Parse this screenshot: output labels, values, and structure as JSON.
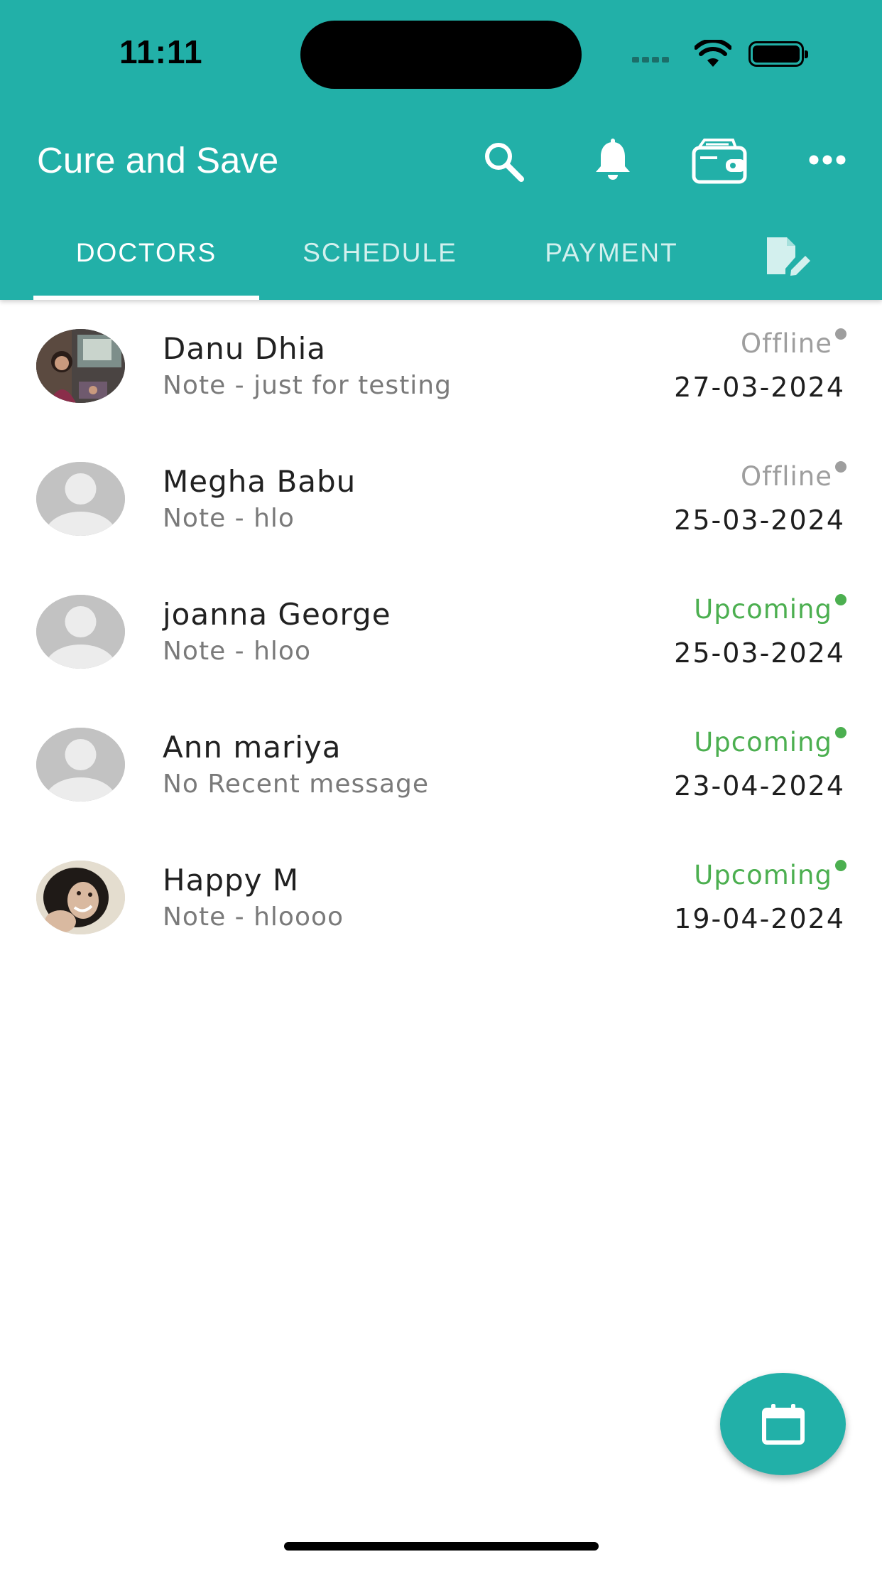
{
  "status_bar": {
    "time": "11:11"
  },
  "header": {
    "title": "Cure and Save",
    "accent_color": "#22b0a8"
  },
  "icons": {
    "search": "search-icon",
    "notifications": "bell-icon",
    "wallet": "wallet-icon",
    "more": "more-horizontal-icon",
    "edit_document": "edit-document-icon",
    "calendar": "calendar-icon"
  },
  "tabs": [
    {
      "label": "DOCTORS",
      "active": true
    },
    {
      "label": "SCHEDULE",
      "active": false
    },
    {
      "label": "PAYMENT",
      "active": false
    }
  ],
  "doctors": [
    {
      "name": "Danu Dhia",
      "note": "Note - just for testing",
      "status": "Offline",
      "date": "27-03-2024",
      "avatar": "photo"
    },
    {
      "name": "Megha Babu",
      "note": "Note - hlo",
      "status": "Offline",
      "date": "25-03-2024",
      "avatar": "placeholder"
    },
    {
      "name": "joanna George",
      "note": "Note - hloo",
      "status": "Upcoming",
      "date": "25-03-2024",
      "avatar": "placeholder"
    },
    {
      "name": "Ann mariya",
      "note": "No Recent message",
      "status": "Upcoming",
      "date": "23-04-2024",
      "avatar": "placeholder"
    },
    {
      "name": "Happy M",
      "note": "Note - hloooo",
      "status": "Upcoming",
      "date": "19-04-2024",
      "avatar": "photo"
    }
  ],
  "status_colors": {
    "Offline": "#9e9e9e",
    "Upcoming": "#4caf50"
  }
}
